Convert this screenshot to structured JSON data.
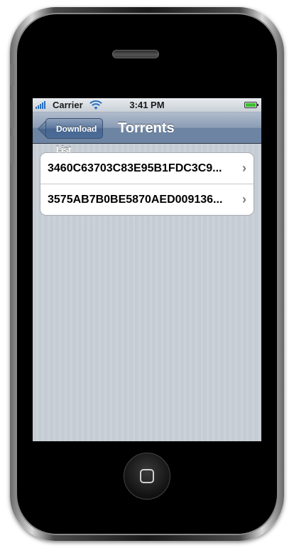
{
  "status_bar": {
    "carrier": "Carrier",
    "time": "3:41 PM",
    "signal_icon": "signal-bars-icon",
    "wifi_icon": "wifi-icon",
    "battery_icon": "battery-icon",
    "battery_color": "#3bbf2c",
    "battery_level": 1.0
  },
  "navbar": {
    "back_label": "Download List",
    "title": "Torrents"
  },
  "torrents": [
    {
      "label": "3460C63703C83E95B1FDC3C9..."
    },
    {
      "label": "3575AB7B0BE5870AED009136..."
    }
  ],
  "colors": {
    "navbar": "#6d84a2",
    "background": "#c5ccd4"
  }
}
